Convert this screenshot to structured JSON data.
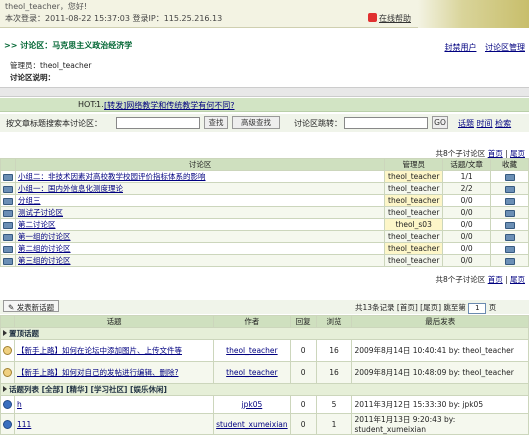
{
  "header": {
    "welcome": "theol_teacher，您好!",
    "login_info": "本次登录：2011-08-22 15:37:03 登录IP：115.25.216.13",
    "help": "在线帮助"
  },
  "crumb": ">> 讨论区：马克思主义政治经济学",
  "toplinks": [
    "封禁用户",
    "讨论区管理"
  ],
  "admin_label": "管理员：theol_teacher",
  "desc_label": "讨论区说明：",
  "hot": {
    "label": "HOT:",
    "num": "1.",
    "text": "[转发]网络教学和传统教学有何不同?"
  },
  "search": {
    "label": "按文章标题搜索本讨论区：",
    "btn_search": "查找",
    "btn_adv": "高级查找",
    "jump_label": "讨论区跳转：",
    "btn_go": "GO",
    "links": [
      "话题",
      "时间",
      "检索"
    ]
  },
  "pager_forums": {
    "total": "共8个子讨论区",
    "first": "首页",
    "last": "尾页"
  },
  "forums": {
    "headers": [
      "讨论区",
      "管理员",
      "话题/文章",
      "收藏"
    ],
    "rows": [
      {
        "name": "小组二：非技术因素对高校教学校园评价指标体系的影响",
        "admin": "theol_teacher",
        "count": "1/1"
      },
      {
        "name": "小组一：国内外信息化测度理论",
        "admin": "theol_teacher",
        "count": "2/2"
      },
      {
        "name": "分组三",
        "admin": "theol_teacher",
        "count": "0/0"
      },
      {
        "name": "测试子讨论区",
        "admin": "theol_teacher",
        "count": "0/0"
      },
      {
        "name": "第二讨论区",
        "admin": "theol_s03",
        "count": "0/0"
      },
      {
        "name": "第一组的讨论区",
        "admin": "theol_teacher",
        "count": "0/0"
      },
      {
        "name": "第二组的讨论区",
        "admin": "theol_teacher",
        "count": "0/0"
      },
      {
        "name": "第三组的讨论区",
        "admin": "theol_teacher",
        "count": "0/0"
      }
    ]
  },
  "newtopic": "发表新话题",
  "pager_topics": {
    "text": "共13条记录 [首页] [尾页] 跳至第",
    "page": "1",
    "suffix": "页"
  },
  "topics": {
    "headers": [
      "话题",
      "作者",
      "回复",
      "浏览",
      "最后发表"
    ],
    "pinned_label": "置顶话题",
    "pinned": [
      {
        "title": "【新手上路】如何在论坛中添加图片、上传文件等",
        "author": "theol_teacher",
        "reply": "0",
        "view": "16",
        "last": "2009年8月14日 10:40:41 by: theol_teacher"
      },
      {
        "title": "【新手上路】如何对自己的发帖进行编辑、删除?",
        "author": "theol_teacher",
        "reply": "0",
        "view": "16",
        "last": "2009年8月14日 10:48:09 by: theol_teacher"
      }
    ],
    "list_label": "话题列表 [全部] [精华] [学习社区] [娱乐休闲]",
    "list": [
      {
        "title": "h",
        "author": "jpk05",
        "reply": "0",
        "view": "5",
        "last": "2011年3月12日 15:33:30 by: jpk05"
      },
      {
        "title": "111",
        "author": "student_xumeixian",
        "reply": "0",
        "view": "1",
        "last": "2011年1月13日 9:20:43 by: student_xumeixian"
      }
    ]
  }
}
